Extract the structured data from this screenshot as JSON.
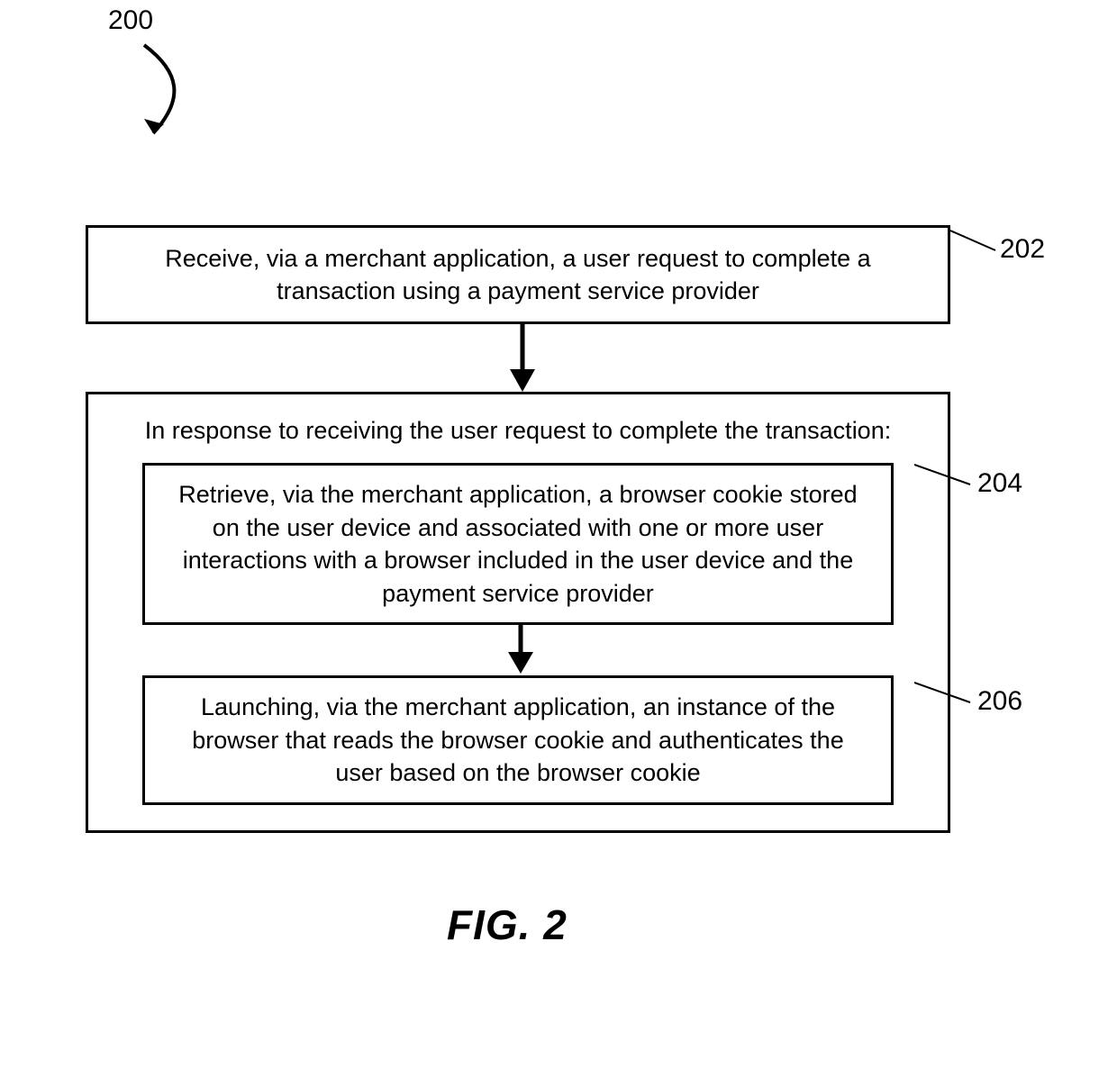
{
  "figure": {
    "number_label": "200",
    "caption": "FIG. 2",
    "steps": {
      "s202": {
        "ref": "202",
        "text": "Receive, via a merchant application, a user request to complete a transaction using a payment service provider"
      },
      "outer": {
        "title": "In response to receiving the user request to complete the transaction:"
      },
      "s204": {
        "ref": "204",
        "text": "Retrieve, via the merchant application, a browser cookie stored on the user device and associated with one or more user interactions with a browser included in the user device and the payment service provider"
      },
      "s206": {
        "ref": "206",
        "text": "Launching, via the merchant application, an instance of the browser that reads the browser cookie and authenticates the user based on the browser cookie"
      }
    }
  }
}
